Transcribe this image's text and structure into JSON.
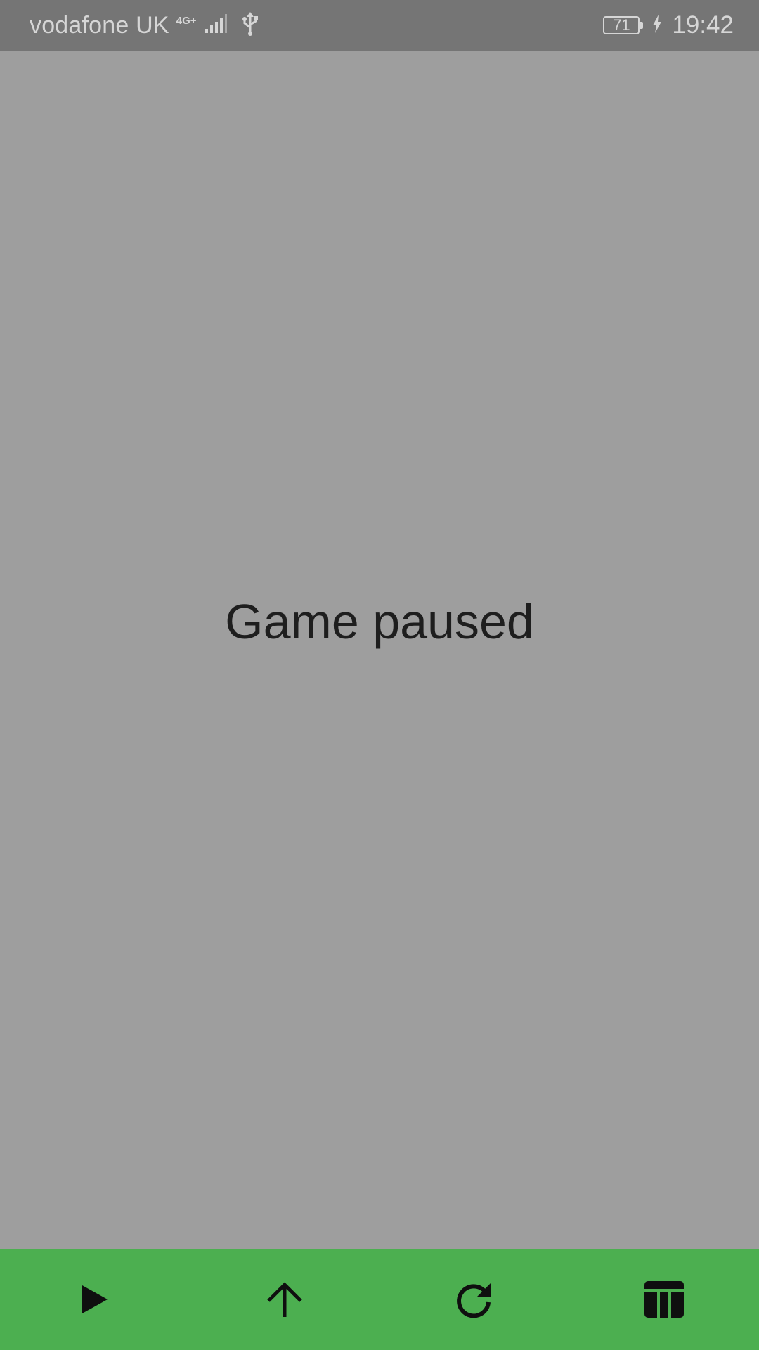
{
  "status_bar": {
    "carrier": "vodafone UK",
    "network_type": "4G+",
    "battery_level": "71",
    "time": "19:42",
    "icons": [
      "signal-icon",
      "usb-icon",
      "battery-icon",
      "charging-icon"
    ]
  },
  "main": {
    "message": "Game paused"
  },
  "bottom_bar": {
    "background_color": "#4caf50",
    "buttons": [
      {
        "name": "play-button",
        "icon": "play-icon"
      },
      {
        "name": "move-up-button",
        "icon": "arrow-up-icon"
      },
      {
        "name": "restart-button",
        "icon": "refresh-icon"
      },
      {
        "name": "leaderboard-button",
        "icon": "table-icon"
      }
    ]
  },
  "colors": {
    "status_bar": "#757575",
    "overlay": "#9e9e9e",
    "accent": "#4caf50",
    "text": "#1e1e1e"
  }
}
